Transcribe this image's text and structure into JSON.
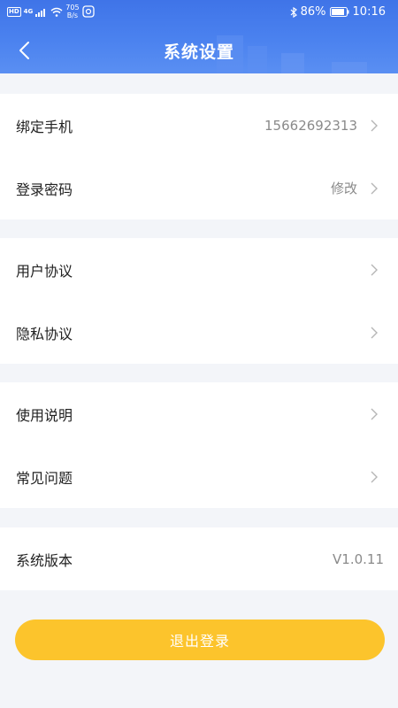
{
  "status_bar": {
    "hd_badge": "HD",
    "network": "4G",
    "speed_value": "705",
    "speed_unit": "B/s",
    "battery": "86%",
    "time": "10:16"
  },
  "nav": {
    "title": "系统设置"
  },
  "sections": {
    "account": {
      "phone": {
        "label": "绑定手机",
        "value": "15662692313"
      },
      "password": {
        "label": "登录密码",
        "value": "修改"
      }
    },
    "agreements": {
      "user": {
        "label": "用户协议"
      },
      "privacy": {
        "label": "隐私协议"
      }
    },
    "help": {
      "guide": {
        "label": "使用说明"
      },
      "faq": {
        "label": "常见问题"
      }
    },
    "version": {
      "label": "系统版本",
      "value": "V1.0.11"
    }
  },
  "logout_label": "退出登录",
  "colors": {
    "header_blue": "#4b82ef",
    "logout_yellow": "#fcc42c",
    "background": "#f3f5f9"
  }
}
